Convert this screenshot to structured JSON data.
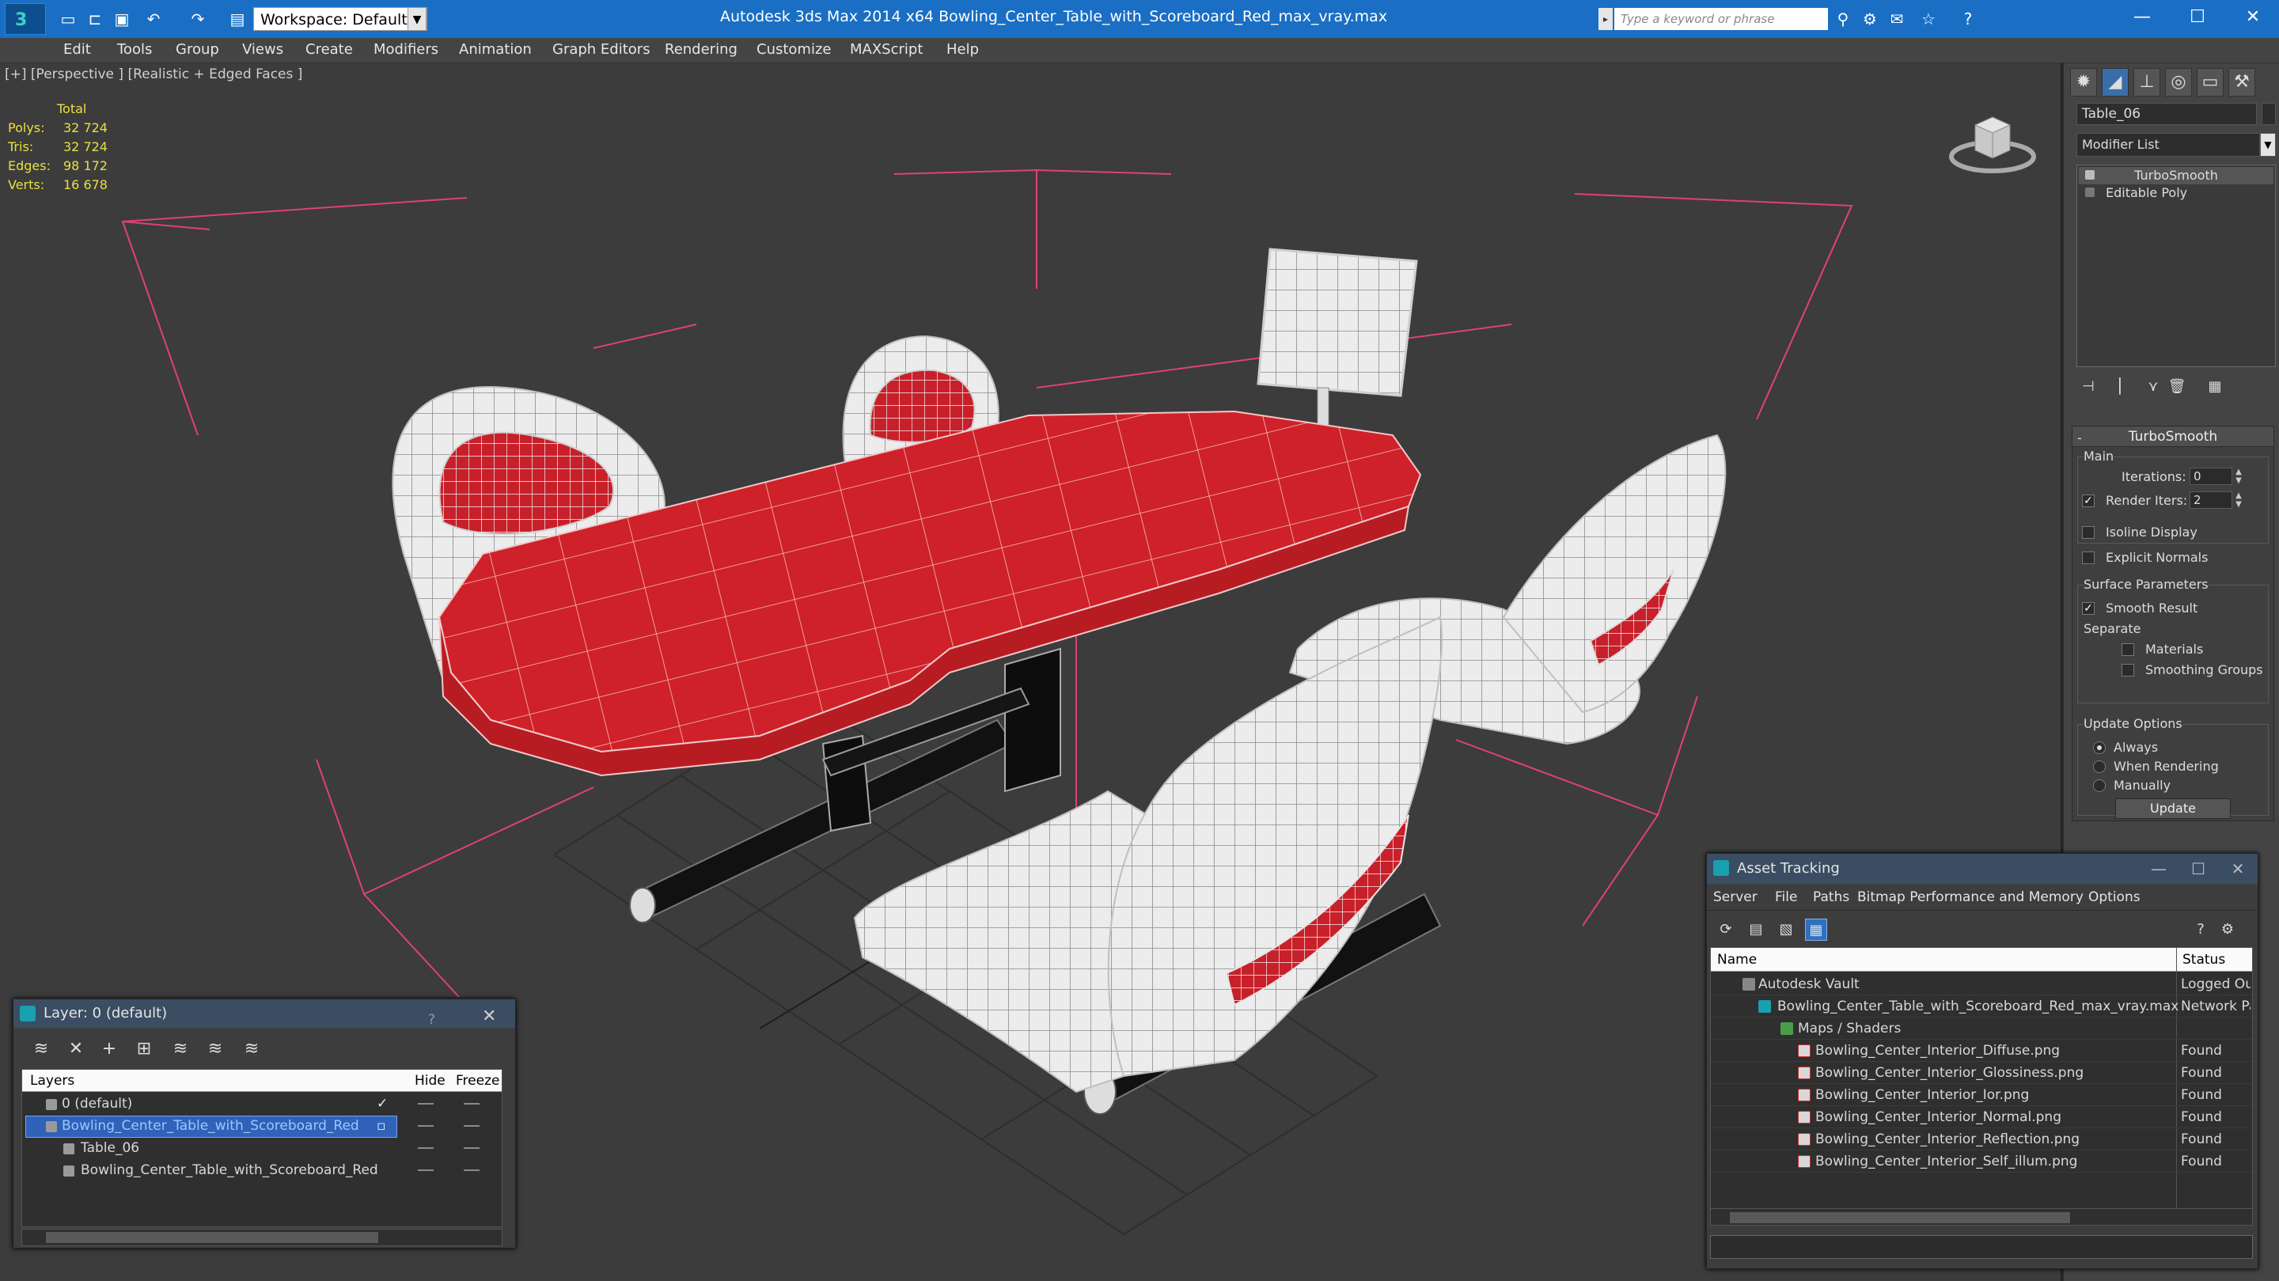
{
  "app": {
    "title": "Autodesk 3ds Max  2014 x64     Bowling_Center_Table_with_Scoreboard_Red_max_vray.max",
    "workspace": "Workspace: Default",
    "search_placeholder": "Type a keyword or phrase"
  },
  "menu": [
    "Edit",
    "Tools",
    "Group",
    "Views",
    "Create",
    "Modifiers",
    "Animation",
    "Graph Editors",
    "Rendering",
    "Customize",
    "MAXScript",
    "Help"
  ],
  "viewport": {
    "label": "[+] [Perspective ] [Realistic + Edged Faces ]",
    "stats_header": "Total",
    "stats": [
      {
        "key": "Polys:",
        "value": "32 724"
      },
      {
        "key": "Tris:",
        "value": "32 724"
      },
      {
        "key": "Edges:",
        "value": "98 172"
      },
      {
        "key": "Verts:",
        "value": "16 678"
      }
    ],
    "colors": {
      "table_red": "#c8202a",
      "mesh_white": "#e6e6e6",
      "bbox_pink": "#e0407a",
      "background": "#3c3c3c"
    }
  },
  "command_panel": {
    "object_name": "Table_06",
    "modifier_list": "Modifier List",
    "stack": [
      "TurboSmooth",
      "Editable Poly"
    ],
    "rollout": {
      "title": "TurboSmooth",
      "main_label": "Main",
      "iterations_label": "Iterations:",
      "iterations_value": "0",
      "render_iters_label": "Render Iters:",
      "render_iters_value": "2",
      "render_iters_checked": true,
      "isoline_label": "Isoline Display",
      "explicit_normals_label": "Explicit Normals",
      "surface_label": "Surface Parameters",
      "smooth_result_label": "Smooth Result",
      "separate_label": "Separate",
      "materials_label": "Materials",
      "smoothing_groups_label": "Smoothing Groups",
      "update_options_label": "Update Options",
      "always_label": "Always",
      "when_rendering_label": "When Rendering",
      "manually_label": "Manually",
      "update_button": "Update"
    }
  },
  "layer_dialog": {
    "title": "Layer: 0 (default)",
    "columns": {
      "layers": "Layers",
      "hide": "Hide",
      "freeze": "Freeze"
    },
    "rows": [
      {
        "name": "0 (default)"
      },
      {
        "name": "Bowling_Center_Table_with_Scoreboard_Red"
      },
      {
        "name": "Table_06"
      },
      {
        "name": "Bowling_Center_Table_with_Scoreboard_Red"
      }
    ]
  },
  "asset_dialog": {
    "title": "Asset Tracking",
    "menu": [
      "Server",
      "File",
      "Paths",
      "Bitmap Performance and Memory",
      "Options"
    ],
    "columns": {
      "name": "Name",
      "status": "Status"
    },
    "rows": [
      {
        "name": "Autodesk Vault",
        "status": "Logged Ou"
      },
      {
        "name": "Bowling_Center_Table_with_Scoreboard_Red_max_vray.max",
        "status": "Network Pa"
      },
      {
        "name": "Maps / Shaders",
        "status": ""
      },
      {
        "name": "Bowling_Center_Interior_Diffuse.png",
        "status": "Found"
      },
      {
        "name": "Bowling_Center_Interior_Glossiness.png",
        "status": "Found"
      },
      {
        "name": "Bowling_Center_Interior_Ior.png",
        "status": "Found"
      },
      {
        "name": "Bowling_Center_Interior_Normal.png",
        "status": "Found"
      },
      {
        "name": "Bowling_Center_Interior_Reflection.png",
        "status": "Found"
      },
      {
        "name": "Bowling_Center_Interior_Self_illum.png",
        "status": "Found"
      }
    ]
  }
}
